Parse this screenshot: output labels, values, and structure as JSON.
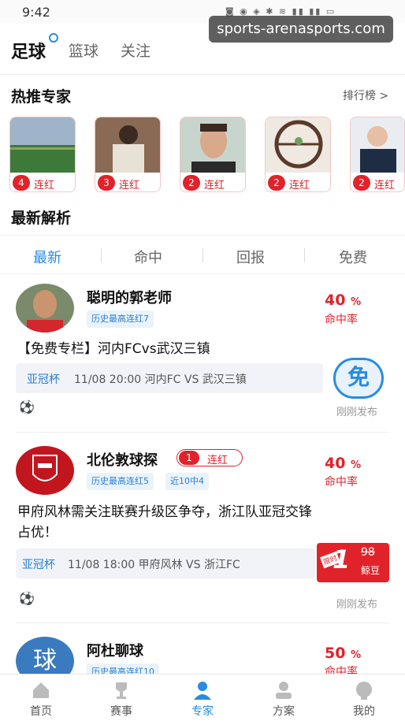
{
  "status": {
    "time": "9:42",
    "battery": "87"
  },
  "watermark": "sports-arenasports.com",
  "top_tabs": [
    {
      "label": "足球"
    },
    {
      "label": "篮球"
    },
    {
      "label": "关注"
    }
  ],
  "hot_experts": {
    "title": "热推专家",
    "rank_label": "排行榜 >",
    "items": [
      {
        "count": "4",
        "streak": "连红"
      },
      {
        "count": "3",
        "streak": "连红"
      },
      {
        "count": "2",
        "streak": "连红"
      },
      {
        "count": "2",
        "streak": "连红"
      },
      {
        "count": "2",
        "streak": "连红"
      }
    ]
  },
  "latest": {
    "title": "最新解析",
    "filters": [
      "最新",
      "命中",
      "回报",
      "免费"
    ]
  },
  "posts": [
    {
      "name": "聪明的郭老师",
      "tags": [
        "历史最高连红7"
      ],
      "rate": "40",
      "rate_unit": "%",
      "rate_label": "命中率",
      "title": "【免费专栏】河内FCvs武汉三镇",
      "league": "亚冠杯",
      "match": "11/08 20:00  河内FC VS 武汉三镇",
      "free_label": "免",
      "published": "刚刚发布"
    },
    {
      "name": "北伦敦球探",
      "streak_count": "1",
      "streak_label": "连红",
      "tags": [
        "历史最高连红5",
        "近10中4"
      ],
      "rate": "40",
      "rate_unit": "%",
      "rate_label": "命中率",
      "title_line1": "甲府风林需关注联赛升级区争夺，浙江队亚冠交锋",
      "title_line2": "占优！",
      "league": "亚冠杯",
      "match": "11/08 18:00  甲府风林 VS 浙江FC",
      "price_new": "1",
      "price_old": "98",
      "price_unit": "鲸豆",
      "price_tag": "限时",
      "published": "刚刚发布"
    },
    {
      "name": "阿杜聊球",
      "avatar_text": "球",
      "tags": [
        "历史最高连红10"
      ],
      "rate": "50",
      "rate_unit": "%",
      "rate_label": "命中率"
    }
  ],
  "bottom_nav": [
    {
      "label": "首页"
    },
    {
      "label": "赛事"
    },
    {
      "label": "专家"
    },
    {
      "label": "方案"
    },
    {
      "label": "我的"
    }
  ],
  "colors": {
    "accent": "#2a8be0",
    "red": "#e0232b"
  }
}
